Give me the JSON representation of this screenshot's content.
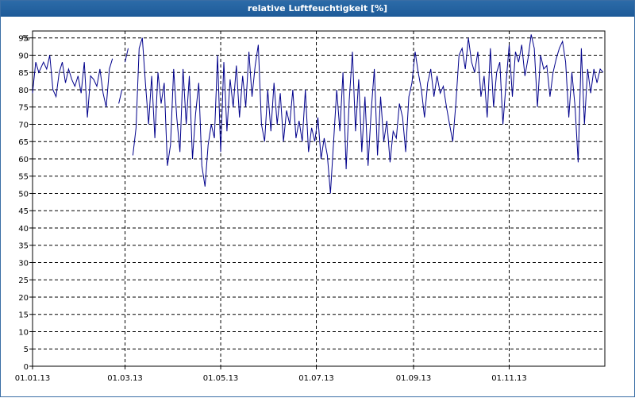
{
  "window": {
    "title": "relative Luftfeuchtigkeit [%]"
  },
  "chart_data": {
    "type": "line",
    "title": "relative Luftfeuchtigkeit [%]",
    "ylabel": "%",
    "xlabel": "",
    "ylim": [
      0,
      97
    ],
    "yticks": [
      0,
      5,
      10,
      15,
      20,
      25,
      30,
      35,
      40,
      45,
      50,
      55,
      60,
      65,
      70,
      75,
      80,
      85,
      90,
      95
    ],
    "xlim": [
      "2013-01-01",
      "2013-12-31"
    ],
    "xticks": [
      {
        "date": "2013-01-01",
        "label": "01.01.13"
      },
      {
        "date": "2013-03-01",
        "label": "01.03.13"
      },
      {
        "date": "2013-05-01",
        "label": "01.05.13"
      },
      {
        "date": "2013-07-01",
        "label": "01.07.13"
      },
      {
        "date": "2013-09-01",
        "label": "01.09.13"
      },
      {
        "date": "2013-11-01",
        "label": "01.11.13"
      }
    ],
    "grid": true,
    "line_color": "#00008b",
    "series": [
      {
        "values": [
          [
            "2013-01-01",
            79
          ],
          [
            "2013-01-03",
            88
          ],
          [
            "2013-01-05",
            85
          ],
          [
            "2013-01-08",
            88
          ],
          [
            "2013-01-10",
            86
          ],
          [
            "2013-01-12",
            90
          ],
          [
            "2013-01-14",
            80
          ],
          [
            "2013-01-16",
            78
          ],
          [
            "2013-01-18",
            85
          ],
          [
            "2013-01-20",
            88
          ],
          [
            "2013-01-22",
            82
          ],
          [
            "2013-01-24",
            86
          ],
          [
            "2013-01-26",
            83
          ],
          [
            "2013-01-28",
            81
          ],
          [
            "2013-01-30",
            84
          ],
          [
            "2013-02-01",
            79
          ],
          [
            "2013-02-03",
            88
          ],
          [
            "2013-02-05",
            72
          ],
          [
            "2013-02-07",
            84
          ],
          [
            "2013-02-09",
            83
          ],
          [
            "2013-02-11",
            81
          ],
          [
            "2013-02-13",
            86
          ],
          [
            "2013-02-15",
            79
          ],
          [
            "2013-02-17",
            75
          ],
          [
            "2013-02-19",
            86
          ],
          [
            "2013-02-21",
            89
          ],
          null,
          [
            "2013-02-25",
            76
          ],
          [
            "2013-02-27",
            80
          ],
          null,
          [
            "2013-03-01",
            88
          ],
          [
            "2013-03-03",
            92
          ],
          null,
          [
            "2013-03-06",
            61
          ],
          [
            "2013-03-08",
            69
          ],
          [
            "2013-03-10",
            92
          ],
          [
            "2013-03-12",
            95
          ],
          [
            "2013-03-14",
            82
          ],
          [
            "2013-03-16",
            70
          ],
          [
            "2013-03-18",
            84
          ],
          [
            "2013-03-20",
            66
          ],
          [
            "2013-03-22",
            85
          ],
          [
            "2013-03-24",
            76
          ],
          [
            "2013-03-26",
            82
          ],
          [
            "2013-03-28",
            58
          ],
          [
            "2013-03-30",
            64
          ],
          [
            "2013-04-01",
            86
          ],
          [
            "2013-04-03",
            72
          ],
          [
            "2013-04-05",
            62
          ],
          [
            "2013-04-07",
            86
          ],
          [
            "2013-04-09",
            70
          ],
          [
            "2013-04-11",
            84
          ],
          [
            "2013-04-13",
            60
          ],
          [
            "2013-04-15",
            73
          ],
          [
            "2013-04-17",
            82
          ],
          [
            "2013-04-19",
            58
          ],
          [
            "2013-04-21",
            52
          ],
          [
            "2013-04-23",
            64
          ],
          [
            "2013-04-25",
            70
          ],
          [
            "2013-04-27",
            66
          ],
          [
            "2013-04-29",
            90
          ],
          [
            "2013-05-01",
            62
          ],
          [
            "2013-05-03",
            88
          ],
          [
            "2013-05-05",
            68
          ],
          [
            "2013-05-07",
            83
          ],
          [
            "2013-05-09",
            75
          ],
          [
            "2013-05-11",
            87
          ],
          [
            "2013-05-13",
            72
          ],
          [
            "2013-05-15",
            84
          ],
          [
            "2013-05-17",
            75
          ],
          [
            "2013-05-19",
            91
          ],
          [
            "2013-05-21",
            78
          ],
          [
            "2013-05-23",
            87
          ],
          [
            "2013-05-25",
            93
          ],
          [
            "2013-05-27",
            70
          ],
          [
            "2013-05-29",
            65
          ],
          [
            "2013-05-31",
            80
          ],
          [
            "2013-06-02",
            68
          ],
          [
            "2013-06-04",
            82
          ],
          [
            "2013-06-06",
            70
          ],
          [
            "2013-06-08",
            79
          ],
          [
            "2013-06-10",
            65
          ],
          [
            "2013-06-12",
            74
          ],
          [
            "2013-06-14",
            70
          ],
          [
            "2013-06-16",
            80
          ],
          [
            "2013-06-18",
            66
          ],
          [
            "2013-06-20",
            71
          ],
          [
            "2013-06-22",
            65
          ],
          [
            "2013-06-24",
            80
          ],
          [
            "2013-06-26",
            62
          ],
          [
            "2013-06-28",
            69
          ],
          [
            "2013-06-30",
            65
          ],
          [
            "2013-07-02",
            72
          ],
          [
            "2013-07-04",
            60
          ],
          [
            "2013-07-06",
            66
          ],
          [
            "2013-07-08",
            61
          ],
          [
            "2013-07-10",
            50
          ],
          [
            "2013-07-12",
            65
          ],
          [
            "2013-07-14",
            80
          ],
          [
            "2013-07-16",
            68
          ],
          [
            "2013-07-18",
            85
          ],
          [
            "2013-07-20",
            57
          ],
          [
            "2013-07-22",
            77
          ],
          [
            "2013-07-24",
            91
          ],
          [
            "2013-07-26",
            68
          ],
          [
            "2013-07-28",
            83
          ],
          [
            "2013-07-30",
            62
          ],
          [
            "2013-08-01",
            78
          ],
          [
            "2013-08-03",
            58
          ],
          [
            "2013-08-05",
            74
          ],
          [
            "2013-08-07",
            86
          ],
          [
            "2013-08-09",
            61
          ],
          [
            "2013-08-11",
            78
          ],
          [
            "2013-08-13",
            65
          ],
          [
            "2013-08-15",
            71
          ],
          [
            "2013-08-17",
            59
          ],
          [
            "2013-08-19",
            68
          ],
          [
            "2013-08-21",
            66
          ],
          [
            "2013-08-23",
            76
          ],
          [
            "2013-08-25",
            72
          ],
          [
            "2013-08-27",
            62
          ],
          [
            "2013-08-29",
            78
          ],
          [
            "2013-08-31",
            82
          ],
          [
            "2013-09-02",
            91
          ],
          [
            "2013-09-04",
            85
          ],
          [
            "2013-09-06",
            80
          ],
          [
            "2013-09-08",
            72
          ],
          [
            "2013-09-10",
            82
          ],
          [
            "2013-09-12",
            86
          ],
          [
            "2013-09-14",
            78
          ],
          [
            "2013-09-16",
            84
          ],
          [
            "2013-09-18",
            79
          ],
          [
            "2013-09-20",
            81
          ],
          [
            "2013-09-22",
            75
          ],
          [
            "2013-09-24",
            70
          ],
          [
            "2013-09-26",
            65
          ],
          [
            "2013-09-28",
            76
          ],
          [
            "2013-09-30",
            90
          ],
          [
            "2013-10-02",
            92
          ],
          [
            "2013-10-04",
            86
          ],
          [
            "2013-10-06",
            95
          ],
          [
            "2013-10-08",
            88
          ],
          [
            "2013-10-10",
            85
          ],
          [
            "2013-10-12",
            91
          ],
          [
            "2013-10-14",
            78
          ],
          [
            "2013-10-16",
            84
          ],
          [
            "2013-10-18",
            72
          ],
          [
            "2013-10-20",
            92
          ],
          [
            "2013-10-22",
            75
          ],
          [
            "2013-10-24",
            85
          ],
          [
            "2013-10-26",
            88
          ],
          [
            "2013-10-28",
            70
          ],
          [
            "2013-10-30",
            82
          ],
          [
            "2013-11-01",
            93
          ],
          [
            "2013-11-03",
            78
          ],
          [
            "2013-11-05",
            91
          ],
          [
            "2013-11-07",
            88
          ],
          [
            "2013-11-09",
            93
          ],
          [
            "2013-11-11",
            84
          ],
          [
            "2013-11-13",
            89
          ],
          [
            "2013-11-15",
            96
          ],
          [
            "2013-11-17",
            92
          ],
          [
            "2013-11-19",
            75
          ],
          [
            "2013-11-21",
            90
          ],
          [
            "2013-11-23",
            86
          ],
          [
            "2013-11-25",
            87
          ],
          [
            "2013-11-27",
            78
          ],
          [
            "2013-11-29",
            85
          ],
          [
            "2013-12-01",
            89
          ],
          [
            "2013-12-03",
            92
          ],
          [
            "2013-12-05",
            94
          ],
          [
            "2013-12-07",
            88
          ],
          [
            "2013-12-09",
            72
          ],
          [
            "2013-12-11",
            85
          ],
          [
            "2013-12-13",
            75
          ],
          [
            "2013-12-15",
            59
          ],
          [
            "2013-12-17",
            92
          ],
          [
            "2013-12-19",
            70
          ],
          [
            "2013-12-21",
            86
          ],
          [
            "2013-12-23",
            79
          ],
          [
            "2013-12-25",
            86
          ],
          [
            "2013-12-27",
            82
          ],
          [
            "2013-12-29",
            86
          ],
          [
            "2013-12-31",
            85
          ]
        ]
      }
    ]
  }
}
